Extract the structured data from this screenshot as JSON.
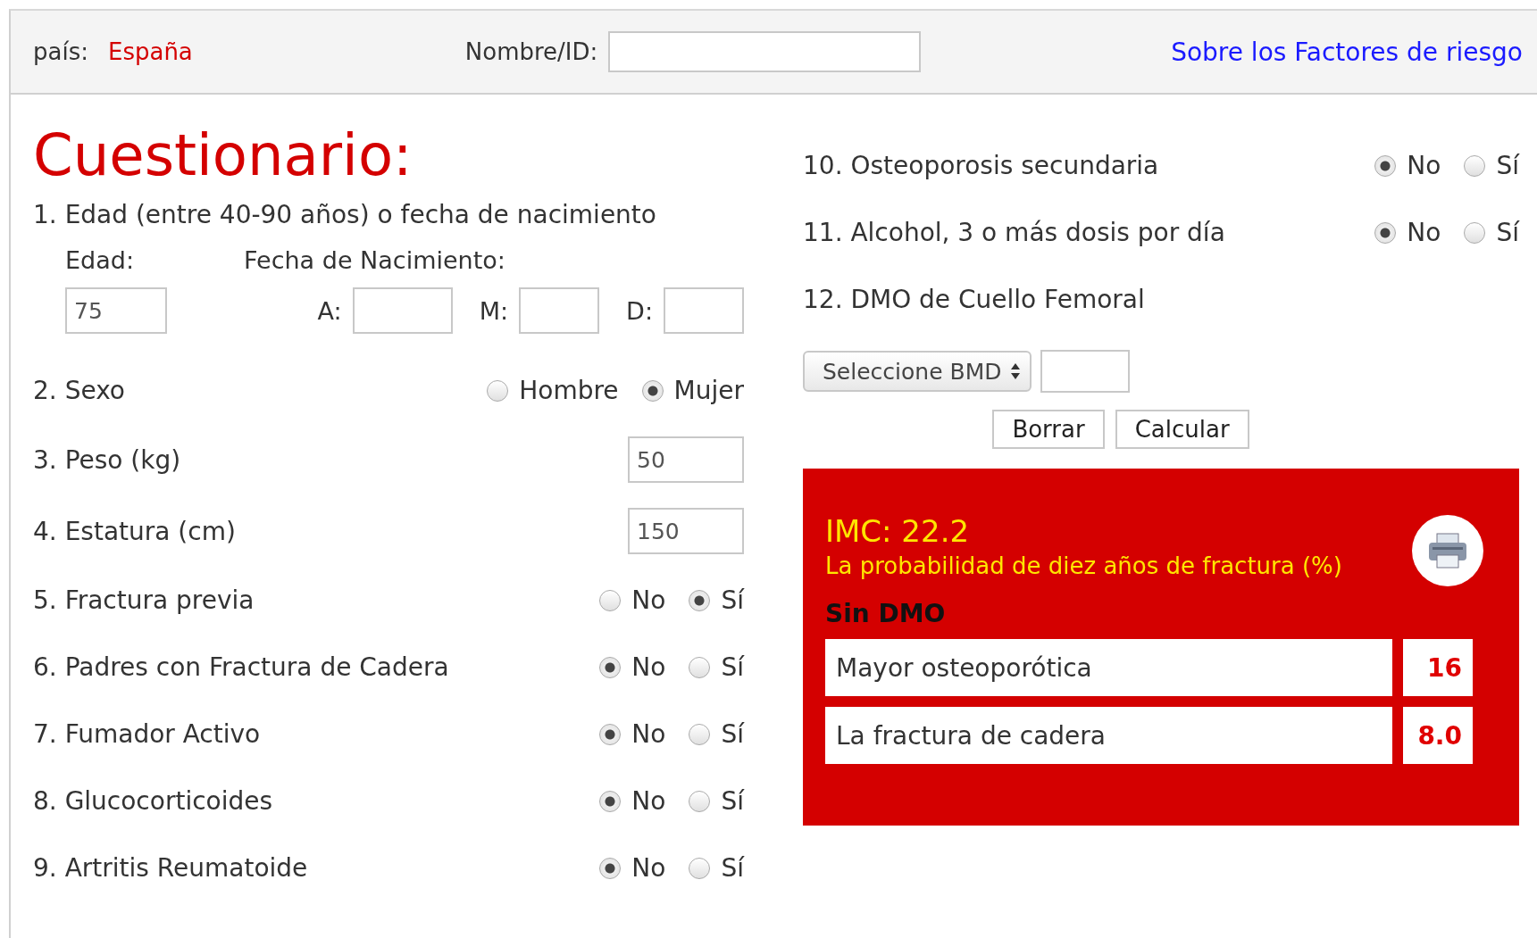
{
  "header": {
    "country_label": "país:",
    "country": "España",
    "name_label": "Nombre/ID:",
    "link": "Sobre los Factores de riesgo"
  },
  "title": "Cuestionario:",
  "left_questions": [
    {
      "kind": "age",
      "number": "1.",
      "label": "Edad (entre 40-90 años) o fecha de nacimiento",
      "age_label": "Edad:",
      "dob_label": "Fecha de Nacimiento:",
      "age_value": "75",
      "date_fields": [
        {
          "label": "A:"
        },
        {
          "label": "M:"
        },
        {
          "label": "D:"
        }
      ]
    },
    {
      "kind": "choice",
      "number": "2.",
      "label": "Sexo",
      "options": [
        {
          "label": "Hombre",
          "selected": false
        },
        {
          "label": "Mujer",
          "selected": true
        }
      ]
    },
    {
      "kind": "input",
      "number": "3.",
      "label": "Peso (kg)",
      "value": "50"
    },
    {
      "kind": "input",
      "number": "4.",
      "label": "Estatura (cm)",
      "value": "150"
    },
    {
      "kind": "choice",
      "number": "5.",
      "label": "Fractura previa",
      "options": [
        {
          "label": "No",
          "selected": false
        },
        {
          "label": "Sí",
          "selected": true
        }
      ]
    },
    {
      "kind": "choice",
      "number": "6.",
      "label": "Padres con Fractura de Cadera",
      "options": [
        {
          "label": "No",
          "selected": true
        },
        {
          "label": "Sí",
          "selected": false
        }
      ]
    },
    {
      "kind": "choice",
      "number": "7.",
      "label": "Fumador Activo",
      "options": [
        {
          "label": "No",
          "selected": true
        },
        {
          "label": "Sí",
          "selected": false
        }
      ]
    },
    {
      "kind": "choice",
      "number": "8.",
      "label": "Glucocorticoides",
      "options": [
        {
          "label": "No",
          "selected": true
        },
        {
          "label": "Sí",
          "selected": false
        }
      ]
    },
    {
      "kind": "choice",
      "number": "9.",
      "label": "Artritis Reumatoide",
      "options": [
        {
          "label": "No",
          "selected": true
        },
        {
          "label": "Sí",
          "selected": false
        }
      ]
    }
  ],
  "right_questions": [
    {
      "kind": "choice",
      "number": "10.",
      "label": "Osteoporosis secundaria",
      "options": [
        {
          "label": "No",
          "selected": true
        },
        {
          "label": "Sí",
          "selected": false
        }
      ]
    },
    {
      "kind": "choice",
      "number": "11.",
      "label": "Alcohol, 3 o más dosis por día",
      "options": [
        {
          "label": "No",
          "selected": true
        },
        {
          "label": "Sí",
          "selected": false
        }
      ]
    },
    {
      "kind": "bmd",
      "number": "12.",
      "label": "DMO de Cuello Femoral",
      "select": "Seleccione BMD"
    }
  ],
  "buttons": [
    "Borrar",
    "Calcular"
  ],
  "results": {
    "bmi": "IMC: 22.2",
    "subtitle": "La probabilidad de diez años de fractura (%)",
    "section": "Sin DMO",
    "rows": [
      {
        "label": "Mayor osteoporótica",
        "value": "16"
      },
      {
        "label": "La fractura de cadera",
        "value": "8.0"
      }
    ]
  }
}
